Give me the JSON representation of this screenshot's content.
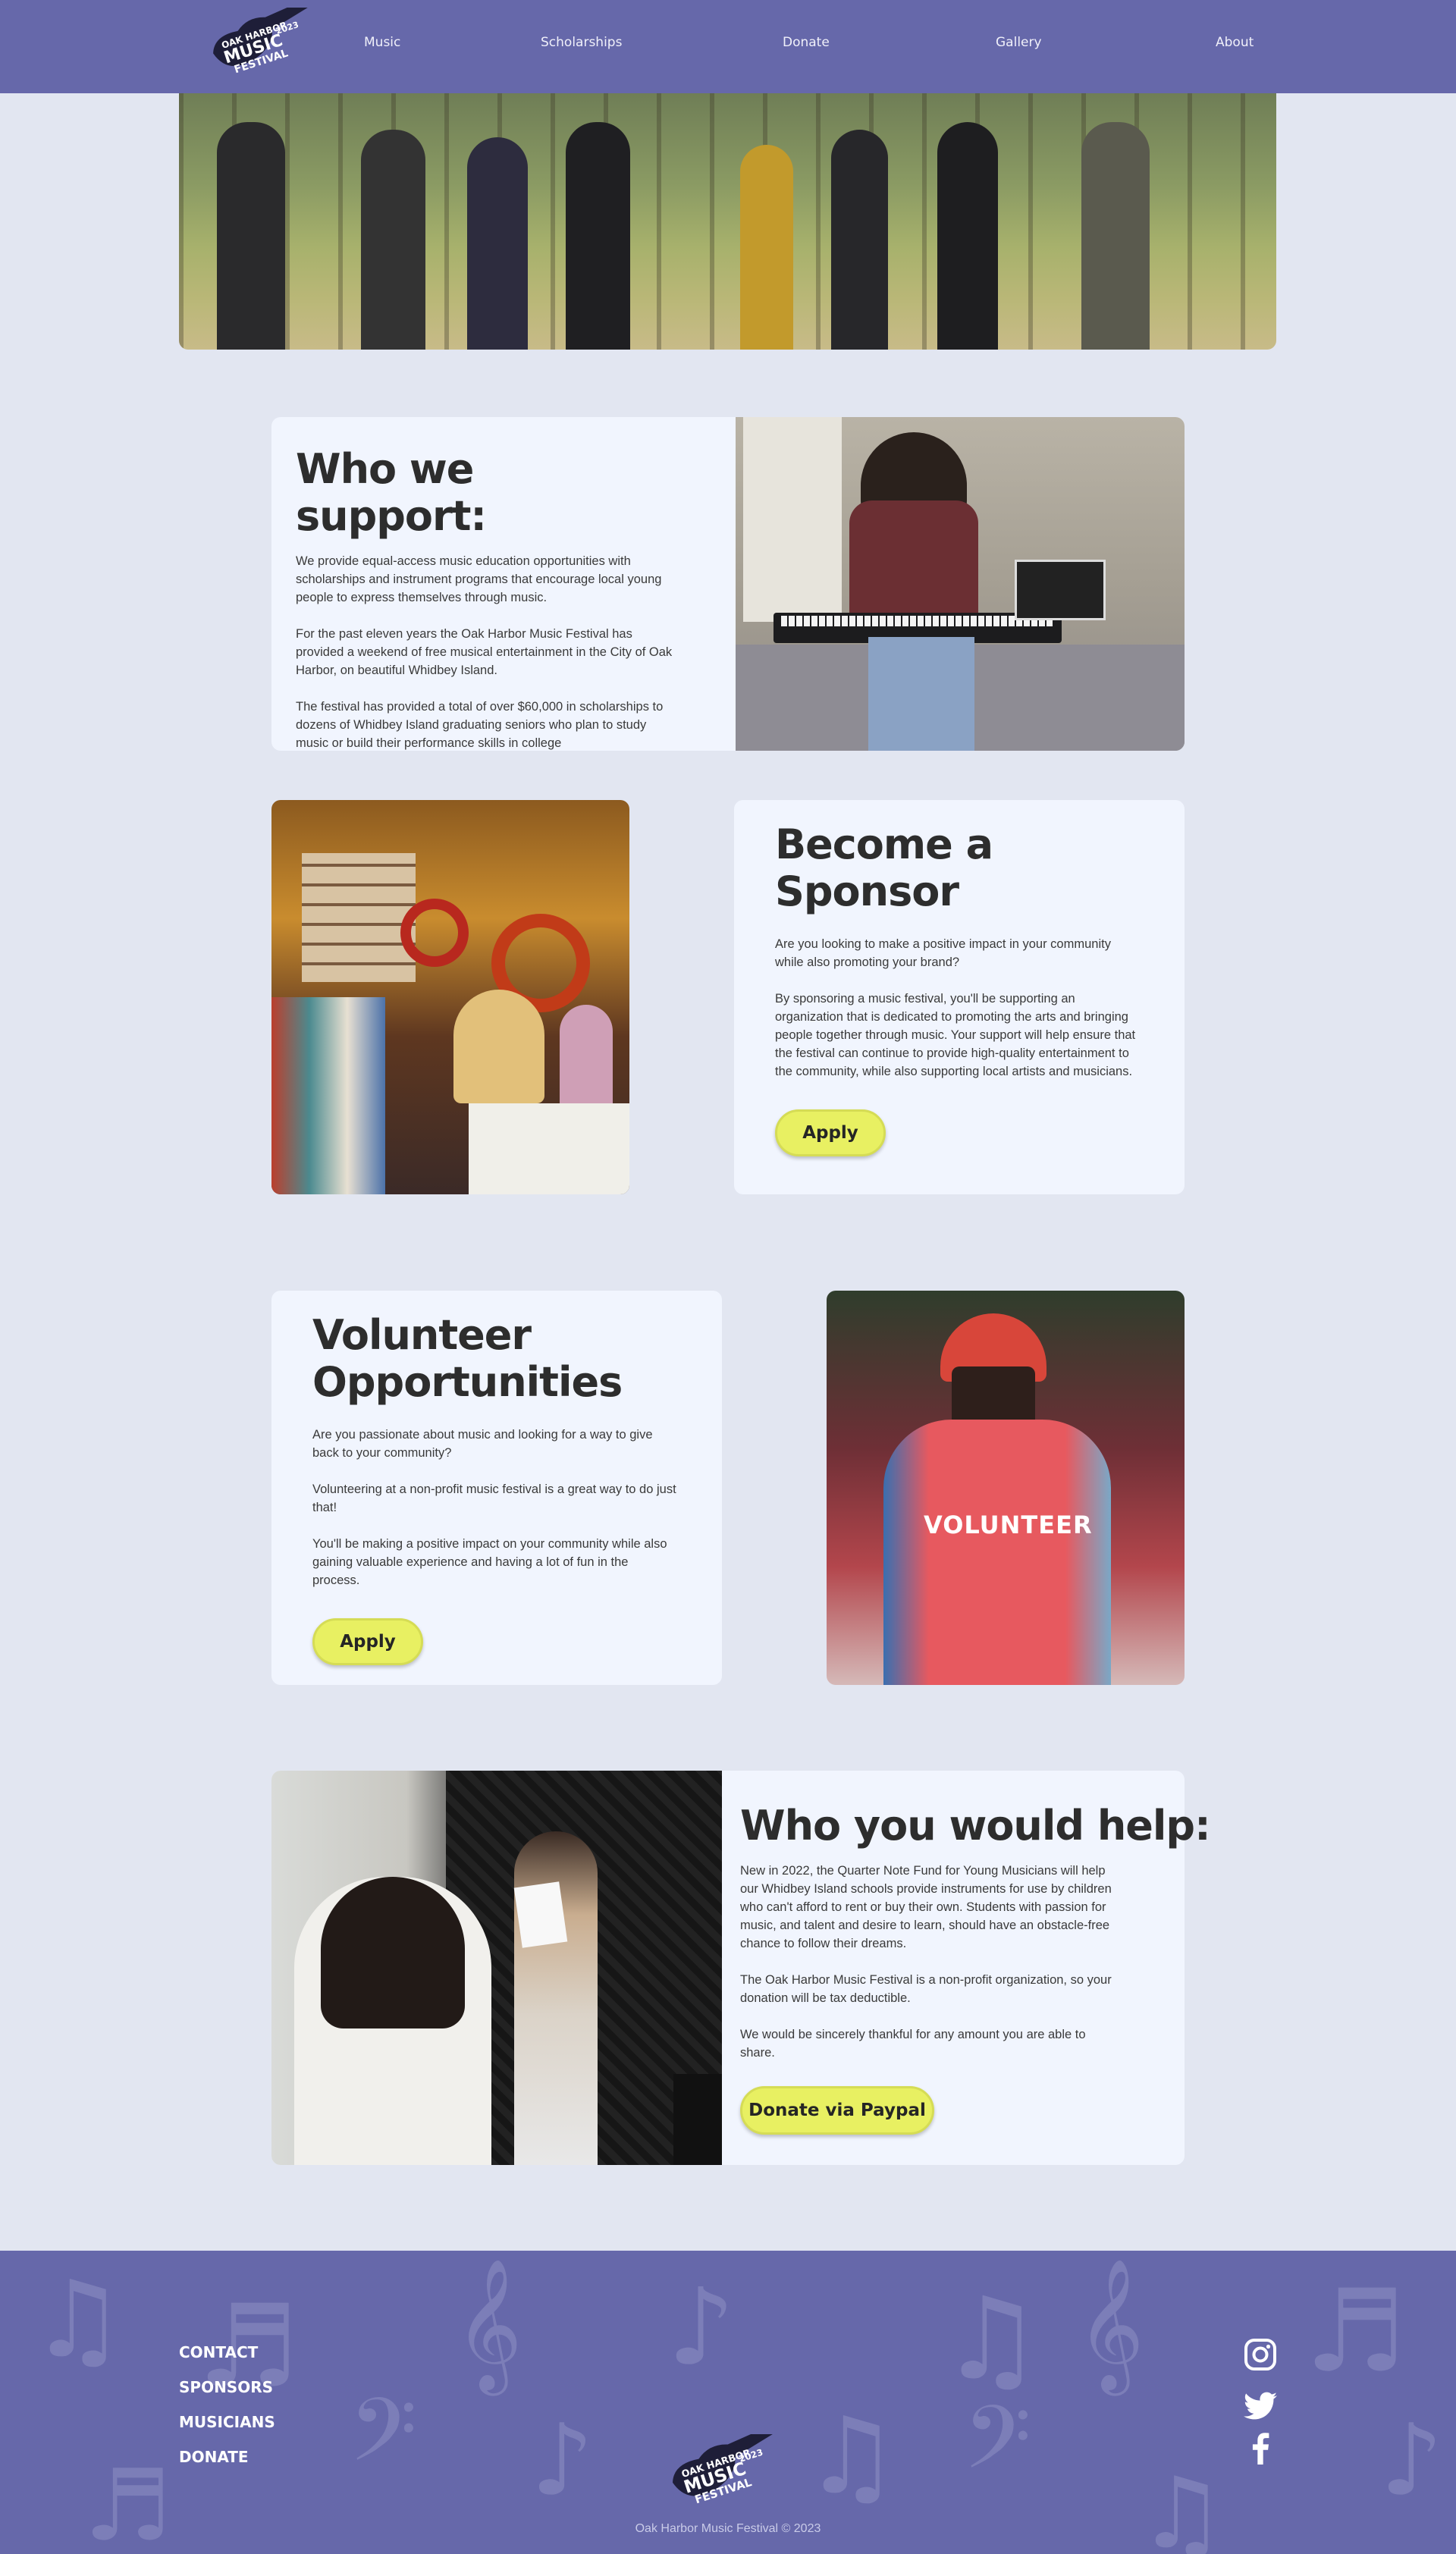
{
  "header": {
    "logo_text": "OAK HARBOR MUSIC FESTIVAL 2023",
    "nav": [
      "Music",
      "Scholarships",
      "Donate",
      "Gallery",
      "About"
    ]
  },
  "support": {
    "title": "Who we support:",
    "paragraphs": [
      "We provide equal-access music education opportunities with scholarships and instrument programs that encourage local young people to express themselves through music.",
      "For the past eleven years the Oak Harbor Music Festival has provided a weekend of free musical entertainment in the City of Oak Harbor, on beautiful Whidbey Island.",
      "The festival has provided a total of over $60,000 in scholarships to dozens of Whidbey Island graduating seniors who plan to study music or build their performance skills in college"
    ]
  },
  "sponsor": {
    "title": "Become a Sponsor",
    "paragraphs": [
      "Are you looking to make a positive impact in your community while also promoting your brand?",
      "By sponsoring a music festival, you'll be supporting an organization that is dedicated to promoting the arts and bringing people together through music. Your support will help ensure that the festival can continue to provide high-quality entertainment to the community, while also supporting local artists and musicians."
    ],
    "button": "Apply"
  },
  "volunteer": {
    "title": "Volunteer Opportunities",
    "paragraphs": [
      "Are you passionate about music and looking for a way to give back to your community?",
      "Volunteering at a non-profit music festival is a great way to do just that!",
      "You'll be making a positive impact on your community while also gaining valuable experience and having a lot of fun in the process."
    ],
    "button": "Apply",
    "shirt_text": "VOLUNTEER"
  },
  "help": {
    "title": "Who you would help:",
    "paragraphs": [
      "New in 2022, the Quarter Note Fund for Young Musicians will help our Whidbey Island schools provide instruments for use by children who can't afford to rent or buy their own. Students with passion for music, and talent and desire to learn, should have an obstacle-free chance to follow their dreams.",
      "The Oak Harbor Music Festival is a non-profit organization, so your donation will be tax deductible.",
      "We would be sincerely thankful for any amount you are able to share."
    ],
    "button": "Donate via Paypal"
  },
  "footer": {
    "links": [
      "CONTACT",
      "SPONSORS",
      "MUSICIANS",
      "DONATE"
    ],
    "copyright": "Oak Harbor Music Festival © 2023",
    "social": [
      "instagram-icon",
      "twitter-icon",
      "facebook-icon"
    ]
  },
  "colors": {
    "header_bg": "#6668aa",
    "page_bg": "#e2e6f1",
    "card_bg": "#f1f5fe",
    "button_bg": "#e8f062"
  }
}
